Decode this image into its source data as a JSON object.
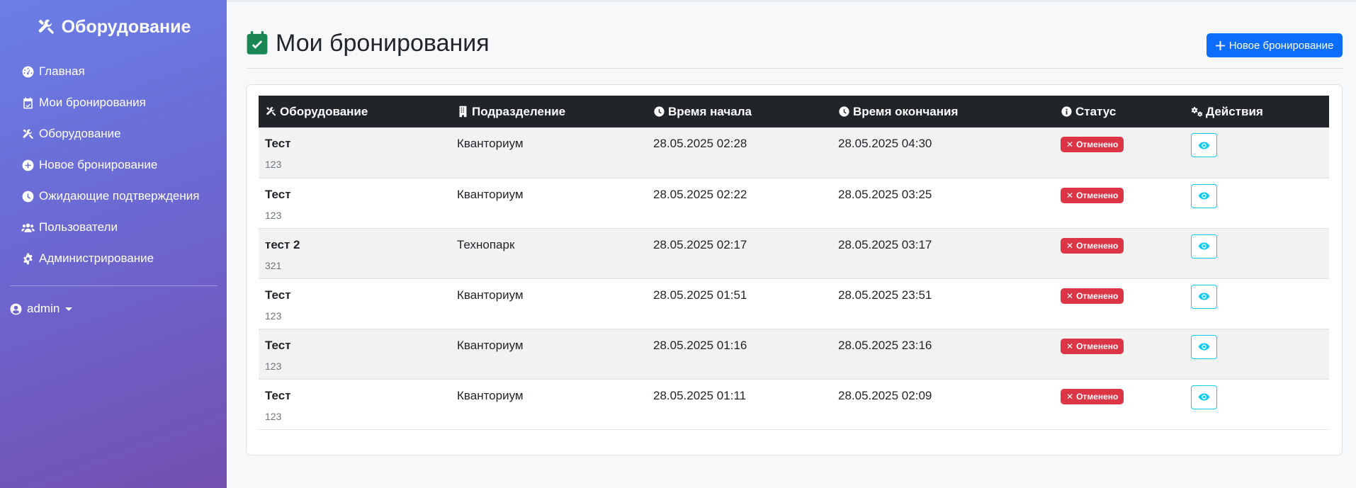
{
  "sidebar": {
    "brand": "Оборудование",
    "items": [
      {
        "label": "Главная",
        "icon": "gauge-icon"
      },
      {
        "label": "Мои бронирования",
        "icon": "calendar-check-icon"
      },
      {
        "label": "Оборудование",
        "icon": "tools-icon"
      },
      {
        "label": "Новое бронирование",
        "icon": "plus-circle-icon"
      },
      {
        "label": "Ожидающие подтверждения",
        "icon": "clock-icon"
      },
      {
        "label": "Пользователи",
        "icon": "users-icon"
      },
      {
        "label": "Администрирование",
        "icon": "gear-icon"
      }
    ],
    "user": "admin"
  },
  "header": {
    "title": "Мои бронирования",
    "new_button": "Новое бронирование"
  },
  "table": {
    "columns": [
      "Оборудование",
      "Подразделение",
      "Время начала",
      "Время окончания",
      "Статус",
      "Действия"
    ],
    "rows": [
      {
        "name": "Тест",
        "code": "123",
        "dept": "Кванториум",
        "start": "28.05.2025 02:28",
        "end": "28.05.2025 04:30",
        "status": "Отменено"
      },
      {
        "name": "Тест",
        "code": "123",
        "dept": "Кванториум",
        "start": "28.05.2025 02:22",
        "end": "28.05.2025 03:25",
        "status": "Отменено"
      },
      {
        "name": "тест 2",
        "code": "321",
        "dept": "Технопарк",
        "start": "28.05.2025 02:17",
        "end": "28.05.2025 03:17",
        "status": "Отменено"
      },
      {
        "name": "Тест",
        "code": "123",
        "dept": "Кванториум",
        "start": "28.05.2025 01:51",
        "end": "28.05.2025 23:51",
        "status": "Отменено"
      },
      {
        "name": "Тест",
        "code": "123",
        "dept": "Кванториум",
        "start": "28.05.2025 01:16",
        "end": "28.05.2025 23:16",
        "status": "Отменено"
      },
      {
        "name": "Тест",
        "code": "123",
        "dept": "Кванториум",
        "start": "28.05.2025 01:11",
        "end": "28.05.2025 02:09",
        "status": "Отменено"
      }
    ]
  },
  "colors": {
    "sidebar_gradient_start": "#6a7fe6",
    "sidebar_gradient_end": "#7350b0",
    "primary": "#0d6efd",
    "danger": "#dc3545",
    "info": "#0dcaf0",
    "success_icon": "#198754",
    "table_header": "#212529"
  }
}
